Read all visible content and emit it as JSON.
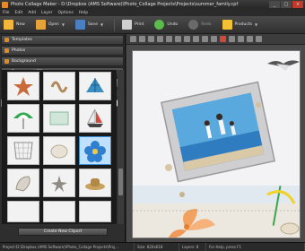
{
  "window": {
    "title": "Photo Collage Maker - D:\\Dropbox (AMS Software)\\Photo_Collage Projects\\Projects\\summer_family.cpf",
    "buttons": [
      "_",
      "□",
      "×"
    ]
  },
  "menu": [
    "File",
    "Edit",
    "Add",
    "Layer",
    "Options",
    "Help"
  ],
  "toolbar": [
    {
      "label": "New",
      "icon": "new-icon",
      "color": "#f4b63a"
    },
    {
      "label": "Open",
      "icon": "open-icon",
      "color": "#e6a33a"
    },
    {
      "label": "Save",
      "icon": "save-icon",
      "color": "#4a7fc1"
    },
    {
      "label": "Print",
      "icon": "print-icon",
      "color": "#cfcfcf"
    },
    {
      "label": "Undo",
      "icon": "undo-icon",
      "color": "#5dbb4c"
    },
    {
      "label": "Redo",
      "icon": "redo-icon",
      "color": "#6a6a6a"
    },
    {
      "label": "Products",
      "icon": "products-icon",
      "color": "#f2c232"
    }
  ],
  "accordion": [
    {
      "label": "Templates",
      "active": false
    },
    {
      "label": "Photos",
      "active": false
    },
    {
      "label": "Background",
      "active": false
    },
    {
      "label": "Frames and Effects",
      "active": false
    },
    {
      "label": "Text and Clipart",
      "active": true
    }
  ],
  "tabs": [
    {
      "label": "Text",
      "active": false
    },
    {
      "label": "Clipart",
      "active": true
    },
    {
      "label": "Shapes",
      "active": false
    }
  ],
  "category": {
    "selected": "Travel"
  },
  "clipart": [
    {
      "name": "starfish",
      "selected": false
    },
    {
      "name": "rope-knot",
      "selected": false
    },
    {
      "name": "seashell-blue",
      "selected": false
    },
    {
      "name": "beach-umbrella",
      "selected": false
    },
    {
      "name": "glass-plate",
      "selected": false
    },
    {
      "name": "sailboat",
      "selected": false
    },
    {
      "name": "fishing-net",
      "selected": false
    },
    {
      "name": "seashell-white",
      "selected": false
    },
    {
      "name": "blue-flower",
      "selected": true
    },
    {
      "name": "conch-shell",
      "selected": false
    },
    {
      "name": "sea-star-2",
      "selected": false
    },
    {
      "name": "hat",
      "selected": false
    }
  ],
  "create_button": "Create New Clipart",
  "status": {
    "project": "Project:D:\\Dropbox (AMS Software)\\Photo_Collage Projects\\Proj...",
    "size": "Size: 820x618",
    "layers": "Layers: 8",
    "help": "For Help, press F1"
  },
  "colors": {
    "accent": "#e08a1f",
    "canvas": "#f0f0f2"
  }
}
